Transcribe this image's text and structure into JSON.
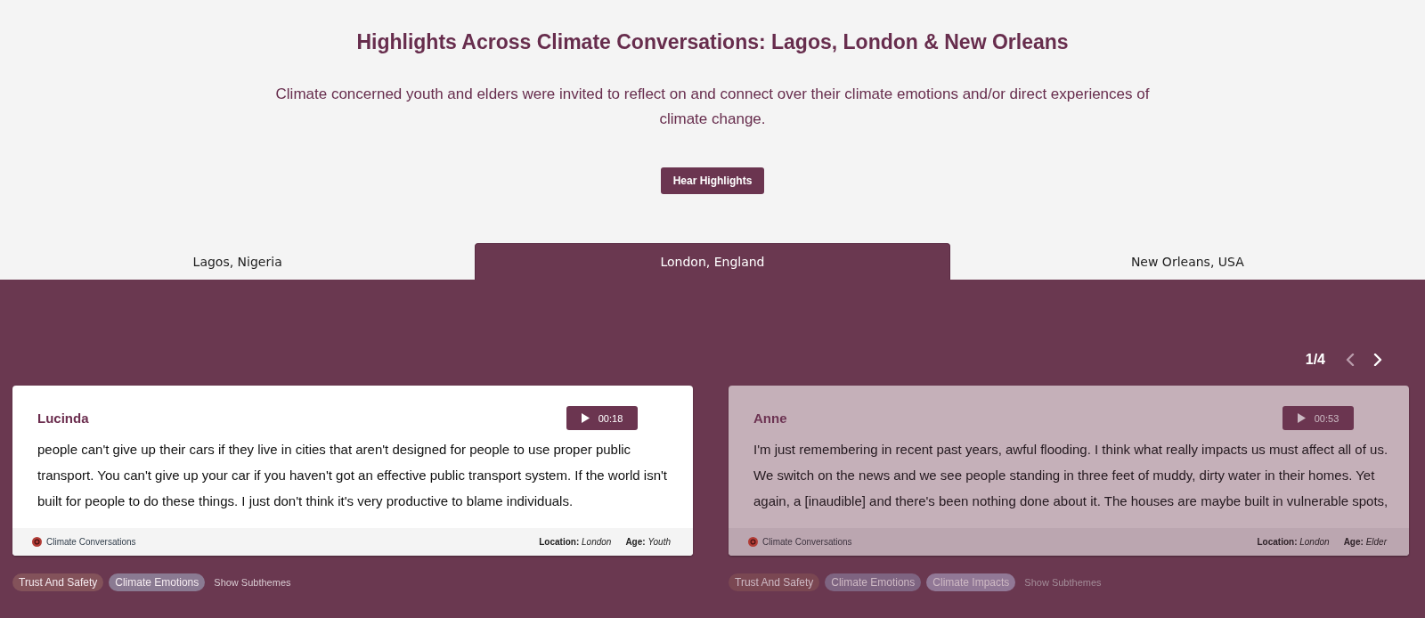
{
  "header": {
    "title": "Highlights Across Climate Conversations: Lagos, London & New Orleans",
    "description": "Climate concerned youth and elders were invited to reflect on and connect over their climate emotions and/or direct experiences of climate change.",
    "button": "Hear Highlights"
  },
  "tabs": [
    {
      "label": "Lagos, Nigeria",
      "selected": false
    },
    {
      "label": "London, England",
      "selected": true
    },
    {
      "label": "New Orleans, USA",
      "selected": false
    }
  ],
  "pager": {
    "label": "1/4",
    "buttons": [
      {
        "kind": "prev",
        "disabled": true
      },
      {
        "kind": "next",
        "disabled": false
      }
    ]
  },
  "cards": [
    {
      "name": "Lucinda",
      "active": true,
      "duration": "00:18",
      "quote": "people can't give up their cars if they live in cities that aren't designed for people to use proper public transport. You can't give up your car if you haven't got an effective public transport system. If the world isn't built for people to do these things. I just don't think it's very productive to blame individuals.",
      "source": "Climate Conversations",
      "location": "**Location:** *London*",
      "age": "**Age:** *Youth*",
      "tags": [
        {
          "label": "Trust And Safety",
          "color": "#83525a"
        },
        {
          "label": "Climate Emotions",
          "color": "#8a7a92"
        }
      ],
      "toggle": "Show Subthemes"
    },
    {
      "name": "Anne",
      "active": false,
      "duration": "00:53",
      "quote": "I'm just remembering in recent past years, awful flooding. I think what really impacts us must affect all of us. We switch on the news and we see people standing in three feet of muddy, dirty water in their homes. Yet again, a [inaudible] and there's been nothing done about it. The houses are maybe built in vulnerable spots,",
      "source": "Climate Conversations",
      "location": "**Location:** *London*",
      "age": "**Age:** *Elder*",
      "tags": [
        {
          "label": "Trust And Safety",
          "color": "#7a4752"
        },
        {
          "label": "Climate Emotions",
          "color": "#7e6481"
        },
        {
          "label": "Climate Impacts",
          "color": "#917896"
        }
      ],
      "toggle": "Show Subthemes"
    }
  ]
}
